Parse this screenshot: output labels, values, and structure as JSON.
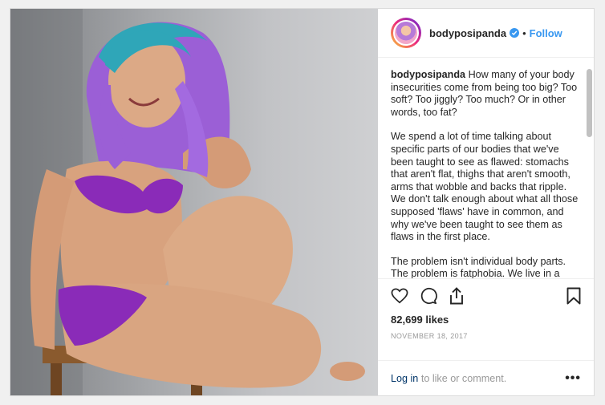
{
  "post": {
    "username": "bodyposipanda",
    "follow_label": "Follow",
    "separator": "•",
    "caption_user": "bodyposipanda",
    "caption_paragraphs": [
      "How many of your body insecurities come from being too big? Too soft? Too jiggly? Too much? Or in other words, too fat?",
      "We spend a lot of time talking about specific parts of our bodies that we've been taught to see as flawed: stomachs that aren't flat, thighs that aren't smooth, arms that wobble and backs that ripple. We don't talk enough about what all those supposed 'flaws' have in common, and why we've been taught to see them as flaws in the first place.",
      "The problem isn't individual body parts. The problem is fatphobia. We live in a culture that teaches us to fear and hate fatness. And by extension, to fear and hate fat people. We're taught a million"
    ],
    "likes": "82,699 likes",
    "date": "NOVEMBER 18, 2017",
    "login_link": "Log in",
    "login_text": " to like or comment.",
    "more_label": "•••"
  },
  "icons": {
    "like": "heart-icon",
    "comment": "comment-icon",
    "share": "share-icon",
    "save": "bookmark-icon",
    "verified": "verified-badge-icon"
  },
  "colors": {
    "accent": "#3897f0",
    "hair_teal": "#2fa6b8",
    "hair_purple": "#9b5fd6",
    "lingerie": "#8a2bb8"
  }
}
